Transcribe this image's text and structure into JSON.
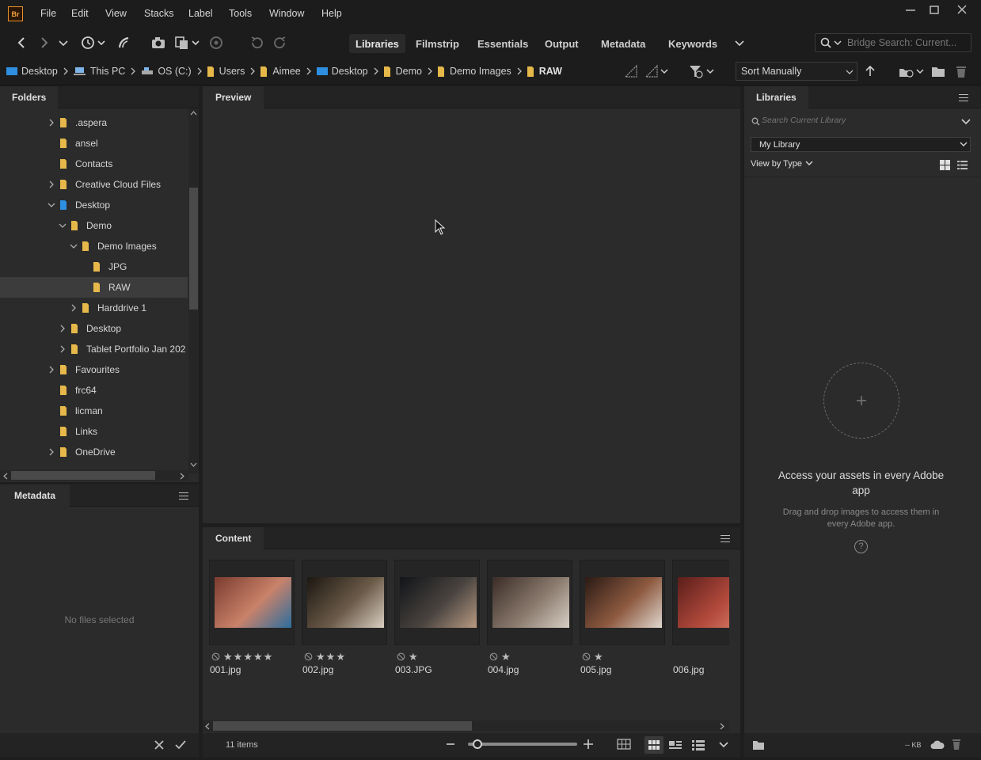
{
  "app": {
    "logo": "Br"
  },
  "menu": [
    "File",
    "Edit",
    "View",
    "Stacks",
    "Label",
    "Tools",
    "Window",
    "Help"
  ],
  "workspaces": [
    "Libraries",
    "Filmstrip",
    "Essentials",
    "Output",
    "Metadata",
    "Keywords"
  ],
  "workspace_active": "Libraries",
  "search": {
    "placeholder": "Bridge Search: Current..."
  },
  "breadcrumb": [
    {
      "label": "Desktop",
      "icon": "desktop-folder-icon"
    },
    {
      "label": "This PC",
      "icon": "computer-icon"
    },
    {
      "label": "OS (C:)",
      "icon": "drive-icon"
    },
    {
      "label": "Users",
      "icon": "folder-icon"
    },
    {
      "label": "Aimee",
      "icon": "folder-icon"
    },
    {
      "label": "Desktop",
      "icon": "desktop-folder-icon"
    },
    {
      "label": "Demo",
      "icon": "folder-icon"
    },
    {
      "label": "Demo Images",
      "icon": "folder-icon"
    },
    {
      "label": "RAW",
      "icon": "folder-icon"
    }
  ],
  "sort": {
    "value": "Sort Manually"
  },
  "folders_panel": {
    "title": "Folders",
    "items": [
      {
        "label": ".aspera",
        "level": 0,
        "expander": "collapsed"
      },
      {
        "label": "ansel",
        "level": 0,
        "expander": "none"
      },
      {
        "label": "Contacts",
        "level": 0,
        "expander": "none"
      },
      {
        "label": "Creative Cloud Files",
        "level": 0,
        "expander": "collapsed"
      },
      {
        "label": "Desktop",
        "level": 0,
        "expander": "expanded"
      },
      {
        "label": "Demo",
        "level": 1,
        "expander": "expanded"
      },
      {
        "label": "Demo Images",
        "level": 2,
        "expander": "expanded"
      },
      {
        "label": "JPG",
        "level": 3,
        "expander": "none"
      },
      {
        "label": "RAW",
        "level": 3,
        "expander": "none",
        "selected": true
      },
      {
        "label": "Harddrive 1",
        "level": 2,
        "expander": "collapsed"
      },
      {
        "label": "Desktop",
        "level": 1,
        "expander": "collapsed"
      },
      {
        "label": "Tablet Portfolio Jan 202",
        "level": 1,
        "expander": "collapsed"
      },
      {
        "label": "Favourites",
        "level": 0,
        "expander": "collapsed"
      },
      {
        "label": "frc64",
        "level": 0,
        "expander": "none"
      },
      {
        "label": "licman",
        "level": 0,
        "expander": "none"
      },
      {
        "label": "Links",
        "level": 0,
        "expander": "none"
      },
      {
        "label": "OneDrive",
        "level": 0,
        "expander": "collapsed"
      }
    ]
  },
  "metadata_panel": {
    "title": "Metadata",
    "empty_text": "No files selected"
  },
  "preview_panel": {
    "title": "Preview"
  },
  "content_panel": {
    "title": "Content",
    "item_count": "11 items",
    "thumbnails": [
      {
        "name": "001.jpg",
        "stars": 5,
        "colors": [
          "#7a3b2e",
          "#c9826a",
          "#2c6e9e"
        ]
      },
      {
        "name": "002.jpg",
        "stars": 3,
        "colors": [
          "#1c1712",
          "#6b5a48",
          "#d9cfc2"
        ]
      },
      {
        "name": "003.JPG",
        "stars": 1,
        "colors": [
          "#111418",
          "#4a4440",
          "#b89a82"
        ]
      },
      {
        "name": "004.jpg",
        "stars": 1,
        "colors": [
          "#3a2c26",
          "#8a7a6e",
          "#d8cfc4"
        ]
      },
      {
        "name": "005.jpg",
        "stars": 1,
        "colors": [
          "#2a1a14",
          "#8e5a40",
          "#e0d8d0"
        ]
      },
      {
        "name": "006.jpg",
        "stars": 0,
        "colors": [
          "#5a1e1a",
          "#b2493c",
          "#e08a70"
        ]
      }
    ]
  },
  "libraries_panel": {
    "title": "Libraries",
    "search_placeholder": "Search Current Library",
    "library_select": "My Library",
    "view_by": "View by Type",
    "empty_title": "Access your assets in every Adobe app",
    "empty_desc": "Drag and drop images to access them in every Adobe app.",
    "size": "-- KB"
  }
}
